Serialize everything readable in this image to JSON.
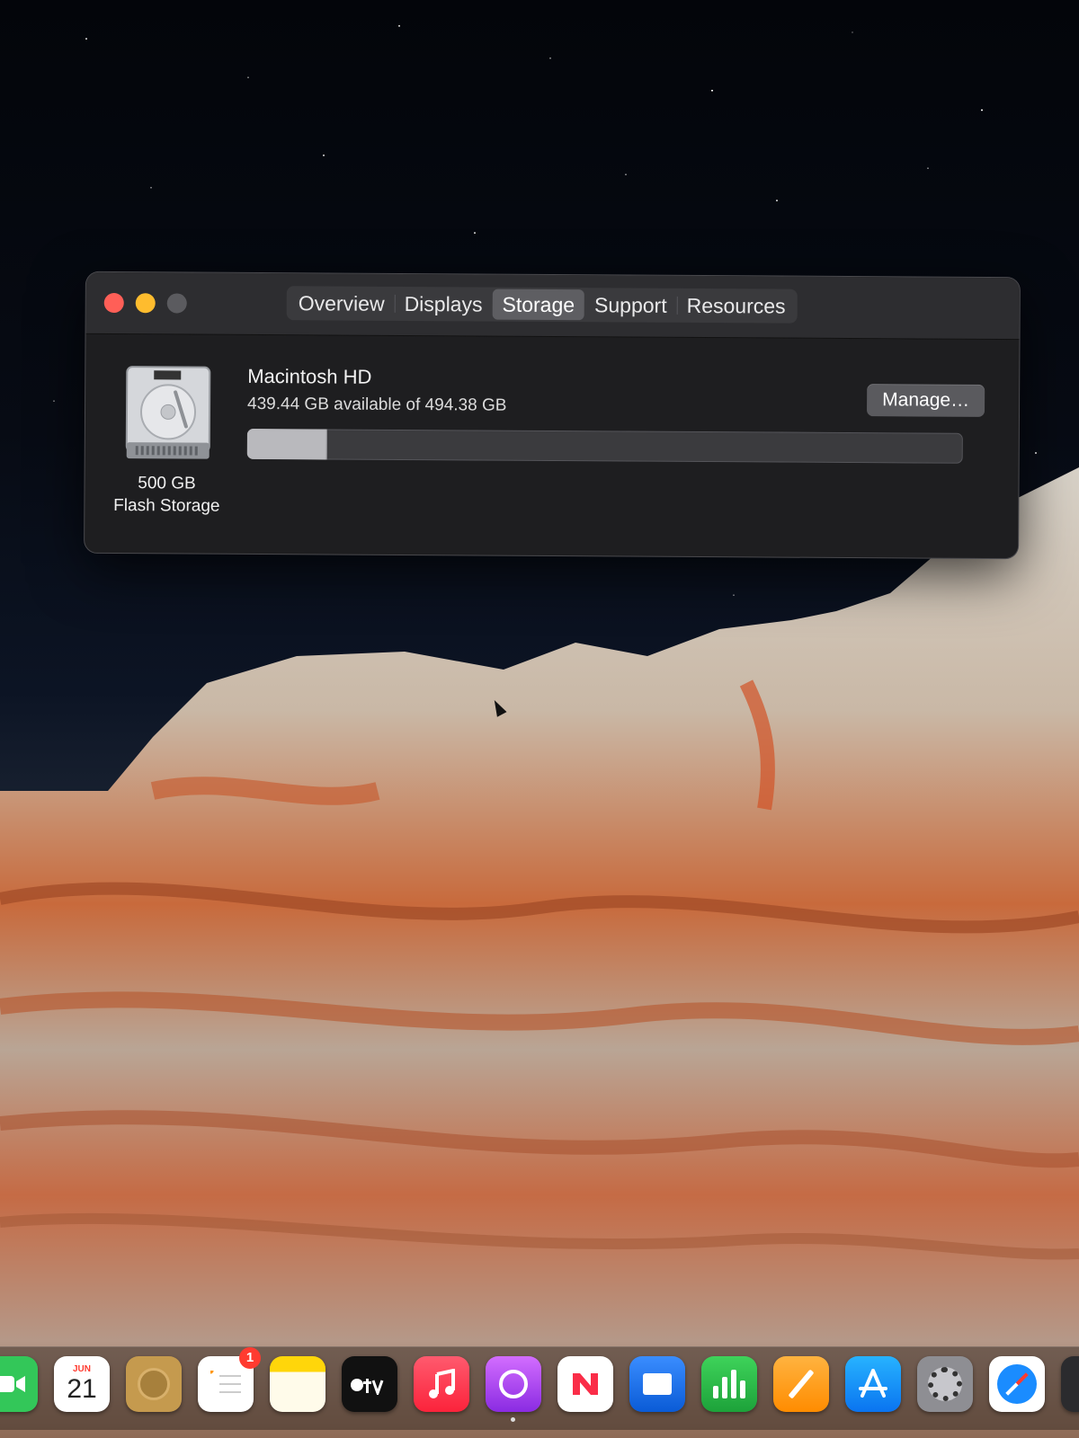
{
  "window": {
    "tabs": [
      {
        "label": "Overview",
        "active": false
      },
      {
        "label": "Displays",
        "active": false
      },
      {
        "label": "Storage",
        "active": true
      },
      {
        "label": "Support",
        "active": false
      },
      {
        "label": "Resources",
        "active": false
      }
    ]
  },
  "storage": {
    "disk_caption_line1": "500 GB",
    "disk_caption_line2": "Flash Storage",
    "volume_name": "Macintosh HD",
    "available_text": "439.44 GB available of 494.38 GB",
    "used_fraction": 0.111,
    "manage_label": "Manage…"
  },
  "dock": {
    "calendar_month": "JUN",
    "calendar_day": "21",
    "reminders_badge": "1",
    "icons": [
      "facetime-icon",
      "calendar-icon",
      "contacts-icon",
      "reminders-icon",
      "notes-icon",
      "apple-tv-icon",
      "music-icon",
      "podcasts-icon",
      "news-icon",
      "keynote-icon",
      "numbers-icon",
      "pages-icon",
      "app-store-icon",
      "system-preferences-icon",
      "safari-icon"
    ]
  },
  "colors": {
    "close": "#ff5f57",
    "minimize": "#febc2e",
    "zoom_disabled": "#5b5b5f",
    "window_bg": "#1e1e20",
    "bar_fill": "#b9b9bd"
  }
}
